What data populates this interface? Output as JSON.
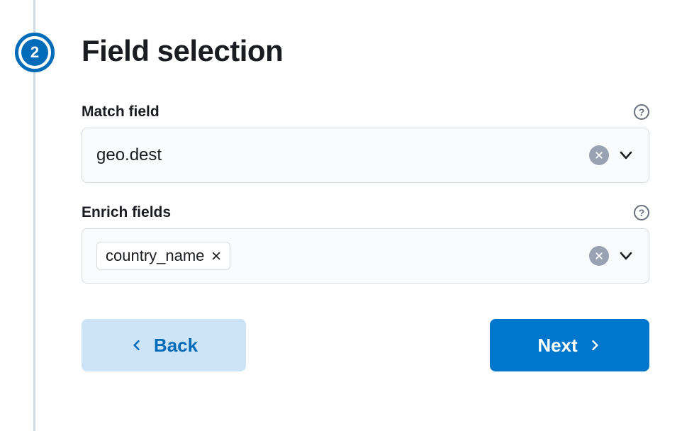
{
  "step": {
    "number": "2",
    "title": "Field selection"
  },
  "match_field": {
    "label": "Match field",
    "value": "geo.dest"
  },
  "enrich_fields": {
    "label": "Enrich fields",
    "chips": [
      {
        "label": "country_name"
      }
    ]
  },
  "buttons": {
    "back": "Back",
    "next": "Next"
  }
}
